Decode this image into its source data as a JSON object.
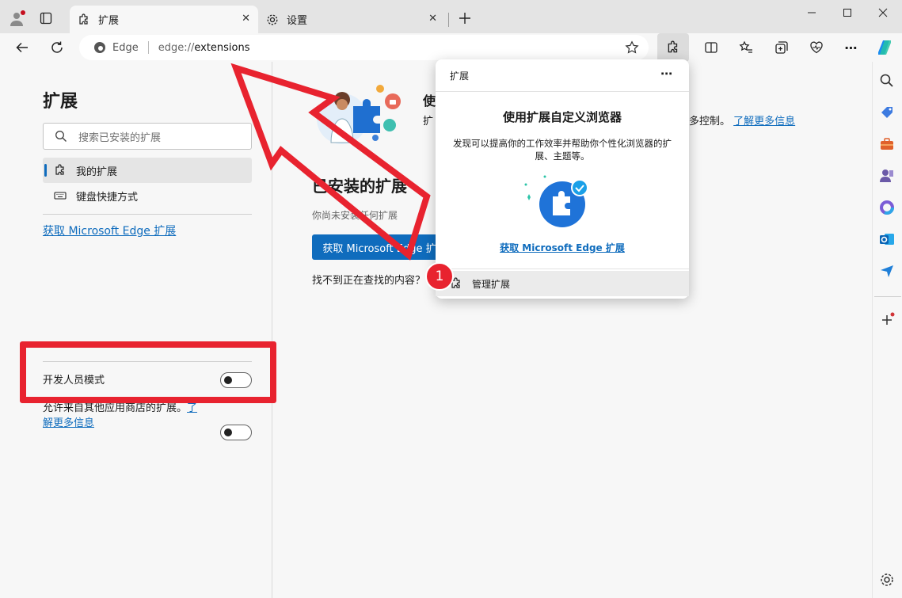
{
  "tabs": [
    {
      "label": "扩展",
      "icon": "puzzle-icon",
      "active": true
    },
    {
      "label": "设置",
      "icon": "gear-icon",
      "active": false
    }
  ],
  "address": {
    "brand": "Edge",
    "url_prefix": "edge://",
    "url_path": "extensions"
  },
  "sidebar": {
    "title": "扩展",
    "search_placeholder": "搜索已安装的扩展",
    "nav": [
      {
        "label": "我的扩展",
        "icon": "puzzle-icon",
        "selected": true
      },
      {
        "label": "键盘快捷方式",
        "icon": "keyboard-icon",
        "selected": false
      }
    ],
    "store_link": "获取 Microsoft Edge 扩展",
    "dev_mode_label": "开发人员模式",
    "dev_mode_on": false,
    "allow_other_stores_text": "允许来自其他应用商店的扩展。",
    "allow_other_stores_link_a": "了",
    "allow_other_stores_link_b": "解更多信息",
    "allow_other_stores_on": false
  },
  "main": {
    "promo_title": "使",
    "promo_text_start": "扩",
    "promo_text_end": "多控制。",
    "promo_link": "了解更多信息",
    "installed_title": "已安装的扩展",
    "installed_empty": "你尚未安装任何扩展",
    "get_button": "获取 Microsoft Edge 扩",
    "cant_find": "找不到正在查找的内容？"
  },
  "popup": {
    "header": "扩展",
    "more": "⋯",
    "title": "使用扩展自定义浏览器",
    "desc": "发现可以提高你的工作效率并帮助你个性化浏览器的扩展、主题等。",
    "link": "获取 Microsoft Edge 扩展",
    "manage": "管理扩展"
  },
  "annotation": {
    "step_number": "1"
  },
  "colors": {
    "accent": "#0f6cbd",
    "annotation_red": "#e8232f",
    "tabbar": "#e4e4e4"
  }
}
